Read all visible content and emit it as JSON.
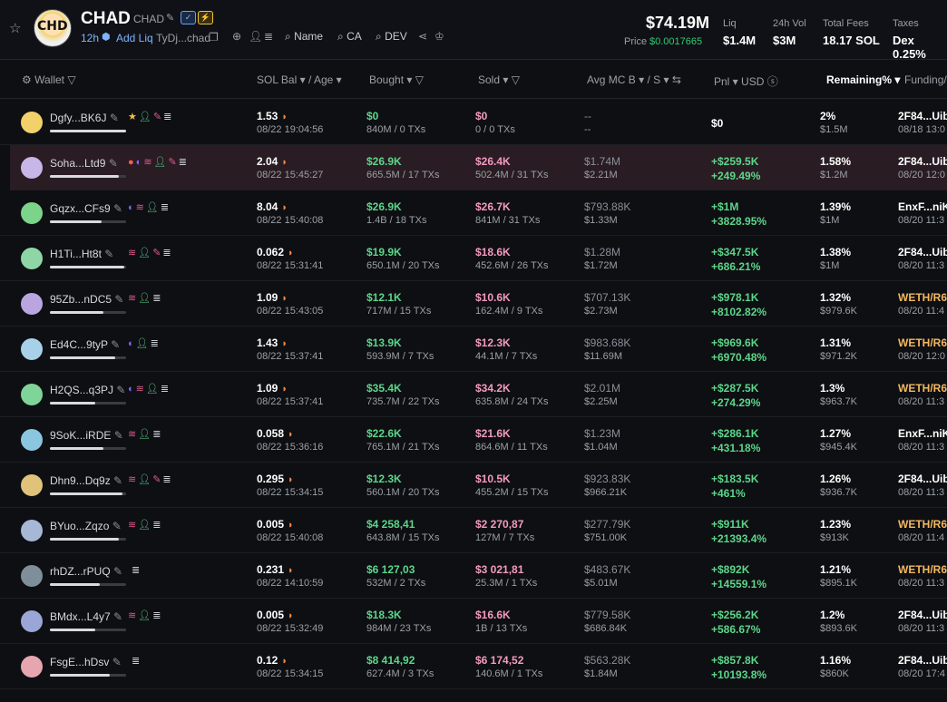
{
  "header": {
    "token_name": "CHAD",
    "token_symbol": "CHAD",
    "age": "12h",
    "add_liq": "Add Liq",
    "contract_short": "TyDj...chad",
    "tools": [
      "Name",
      "CA",
      "DEV"
    ],
    "market_cap": "$74.19M",
    "price_label": "Price",
    "price": "$0.0017665",
    "stats": [
      {
        "label": "Liq",
        "value": "$1.4M"
      },
      {
        "label": "24h Vol",
        "value": "$3M"
      },
      {
        "label": "Total Fees",
        "value": "18.17 SOL"
      },
      {
        "label": "Taxes",
        "value": "Dex 0.25%"
      }
    ]
  },
  "table": {
    "columns": [
      "Wallet",
      "SOL Bal",
      "/ Age",
      "Bought",
      "Sold",
      "Avg MC B",
      "/ S",
      "Pnl",
      "USD",
      "Remaining%",
      "Funding/"
    ],
    "rows": [
      {
        "wallet": "Dgfy...BK6J",
        "bal": "1.53",
        "time": "08/22 19:04:56",
        "bought": "$0",
        "bought_sub": "840M / 0 TXs",
        "sold": "$0",
        "sold_sub": "0 / 0 TXs",
        "avg_b": "--",
        "avg_s": "--",
        "pnl": "$0",
        "pnl_pct": "",
        "rem": "2%",
        "rem_sub": "$1.5M",
        "fund": "2F84...Uib",
        "fund_sub": "08/18 13:0"
      },
      {
        "wallet": "Soha...Ltd9",
        "bal": "2.04",
        "time": "08/22 15:45:27",
        "bought": "$26.9K",
        "bought_sub": "665.5M / 17 TXs",
        "sold": "$26.4K",
        "sold_sub": "502.4M / 31 TXs",
        "avg_b": "$1.74M",
        "avg_s": "$2.21M",
        "pnl": "+$259.5K",
        "pnl_pct": "+249.49%",
        "rem": "1.58%",
        "rem_sub": "$1.2M",
        "fund": "2F84...Uib",
        "fund_sub": "08/20 12:0"
      },
      {
        "wallet": "Gqzx...CFs9",
        "bal": "8.04",
        "time": "08/22 15:40:08",
        "bought": "$26.9K",
        "bought_sub": "1.4B / 18 TXs",
        "sold": "$26.7K",
        "sold_sub": "841M / 31 TXs",
        "avg_b": "$793.88K",
        "avg_s": "$1.33M",
        "pnl": "+$1M",
        "pnl_pct": "+3828.95%",
        "rem": "1.39%",
        "rem_sub": "$1M",
        "fund": "EnxF...niKu",
        "fund_sub": "08/20 11:3"
      },
      {
        "wallet": "H1Ti...Ht8t",
        "bal": "0.062",
        "time": "08/22 15:31:41",
        "bought": "$19.9K",
        "bought_sub": "650.1M / 20 TXs",
        "sold": "$18.6K",
        "sold_sub": "452.6M / 26 TXs",
        "avg_b": "$1.28M",
        "avg_s": "$1.72M",
        "pnl": "+$347.5K",
        "pnl_pct": "+686.21%",
        "rem": "1.38%",
        "rem_sub": "$1M",
        "fund": "2F84...Uib",
        "fund_sub": "08/20 11:3"
      },
      {
        "wallet": "95Zb...nDC5",
        "bal": "1.09",
        "time": "08/22 15:43:05",
        "bought": "$12.1K",
        "bought_sub": "717M / 15 TXs",
        "sold": "$10.6K",
        "sold_sub": "162.4M / 9 TXs",
        "avg_b": "$707.13K",
        "avg_s": "$2.73M",
        "pnl": "+$978.1K",
        "pnl_pct": "+8102.82%",
        "rem": "1.32%",
        "rem_sub": "$979.6K",
        "fund": "WETH/R6",
        "fund_sub": "08/20 11:4"
      },
      {
        "wallet": "Ed4C...9tyP",
        "bal": "1.43",
        "time": "08/22 15:37:41",
        "bought": "$13.9K",
        "bought_sub": "593.9M / 7 TXs",
        "sold": "$12.3K",
        "sold_sub": "44.1M / 7 TXs",
        "avg_b": "$983.68K",
        "avg_s": "$11.69M",
        "pnl": "+$969.6K",
        "pnl_pct": "+6970.48%",
        "rem": "1.31%",
        "rem_sub": "$971.2K",
        "fund": "WETH/R6",
        "fund_sub": "08/20 12:0"
      },
      {
        "wallet": "H2QS...q3PJ",
        "bal": "1.09",
        "time": "08/22 15:37:41",
        "bought": "$35.4K",
        "bought_sub": "735.7M / 22 TXs",
        "sold": "$34.2K",
        "sold_sub": "635.8M / 24 TXs",
        "avg_b": "$2.01M",
        "avg_s": "$2.25M",
        "pnl": "+$287.5K",
        "pnl_pct": "+274.29%",
        "rem": "1.3%",
        "rem_sub": "$963.7K",
        "fund": "WETH/R6",
        "fund_sub": "08/20 11:3"
      },
      {
        "wallet": "9SoK...iRDE",
        "bal": "0.058",
        "time": "08/22 15:36:16",
        "bought": "$22.6K",
        "bought_sub": "765.1M / 21 TXs",
        "sold": "$21.6K",
        "sold_sub": "864.6M / 11 TXs",
        "avg_b": "$1.23M",
        "avg_s": "$1.04M",
        "pnl": "+$286.1K",
        "pnl_pct": "+431.18%",
        "rem": "1.27%",
        "rem_sub": "$945.4K",
        "fund": "EnxF...niKu",
        "fund_sub": "08/20 11:3"
      },
      {
        "wallet": "Dhn9...Dq9z",
        "bal": "0.295",
        "time": "08/22 15:34:15",
        "bought": "$12.3K",
        "bought_sub": "560.1M / 20 TXs",
        "sold": "$10.5K",
        "sold_sub": "455.2M / 15 TXs",
        "avg_b": "$923.83K",
        "avg_s": "$966.21K",
        "pnl": "+$183.5K",
        "pnl_pct": "+461%",
        "rem": "1.26%",
        "rem_sub": "$936.7K",
        "fund": "2F84...Uib",
        "fund_sub": "08/20 11:3"
      },
      {
        "wallet": "BYuo...Zqzo",
        "bal": "0.005",
        "time": "08/22 15:40:08",
        "bought": "$4 258,41",
        "bought_sub": "643.8M / 15 TXs",
        "sold": "$2 270,87",
        "sold_sub": "127M / 7 TXs",
        "avg_b": "$277.79K",
        "avg_s": "$751.00K",
        "pnl": "+$911K",
        "pnl_pct": "+21393.4%",
        "rem": "1.23%",
        "rem_sub": "$913K",
        "fund": "WETH/R6",
        "fund_sub": "08/20 11:4"
      },
      {
        "wallet": "rhDZ...rPUQ",
        "bal": "0.231",
        "time": "08/22 14:10:59",
        "bought": "$6 127,03",
        "bought_sub": "532M / 2 TXs",
        "sold": "$3 021,81",
        "sold_sub": "25.3M / 1 TXs",
        "avg_b": "$483.67K",
        "avg_s": "$5.01M",
        "pnl": "+$892K",
        "pnl_pct": "+14559.1%",
        "rem": "1.21%",
        "rem_sub": "$895.1K",
        "fund": "WETH/R6",
        "fund_sub": "08/20 11:3"
      },
      {
        "wallet": "BMdx...L4y7",
        "bal": "0.005",
        "time": "08/22 15:32:49",
        "bought": "$18.3K",
        "bought_sub": "984M / 23 TXs",
        "sold": "$16.6K",
        "sold_sub": "1B / 13 TXs",
        "avg_b": "$779.58K",
        "avg_s": "$686.84K",
        "pnl": "+$256.2K",
        "pnl_pct": "+586.67%",
        "rem": "1.2%",
        "rem_sub": "$893.6K",
        "fund": "2F84...Uib",
        "fund_sub": "08/20 11:3"
      },
      {
        "wallet": "FsgE...hDsv",
        "bal": "0.12",
        "time": "08/22 15:34:15",
        "bought": "$8 414,92",
        "bought_sub": "627.4M / 3 TXs",
        "sold": "$6 174,52",
        "sold_sub": "140.6M / 1 TXs",
        "avg_b": "$563.28K",
        "avg_s": "$1.84M",
        "pnl": "+$857.8K",
        "pnl_pct": "+10193.8%",
        "rem": "1.16%",
        "rem_sub": "$860K",
        "fund": "2F84...Uib",
        "fund_sub": "08/20 17:4"
      }
    ]
  },
  "colors": {
    "accent_green": "#5cd68a",
    "accent_pink": "#f49ac1",
    "highlight_row": "#2a1c23",
    "link_blue": "#7fb3ff"
  }
}
